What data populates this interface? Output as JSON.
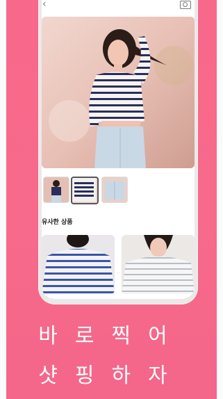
{
  "header": {
    "back_icon": "back-chevron-icon",
    "camera_icon": "camera-icon"
  },
  "product": {
    "hero_alt": "woman-in-striped-crop-top-photo",
    "thumbnails": [
      "thumbnail-1",
      "thumbnail-2",
      "thumbnail-3"
    ],
    "active_thumbnail": 2
  },
  "similar": {
    "title": "유사한 상품",
    "cards": [
      "similar-item-1",
      "similar-item-2"
    ]
  },
  "tagline": {
    "line1": "바로찍어",
    "line2": "샷핑하자"
  },
  "colors": {
    "background": "#f76a8b",
    "accent": "#ffffff"
  }
}
